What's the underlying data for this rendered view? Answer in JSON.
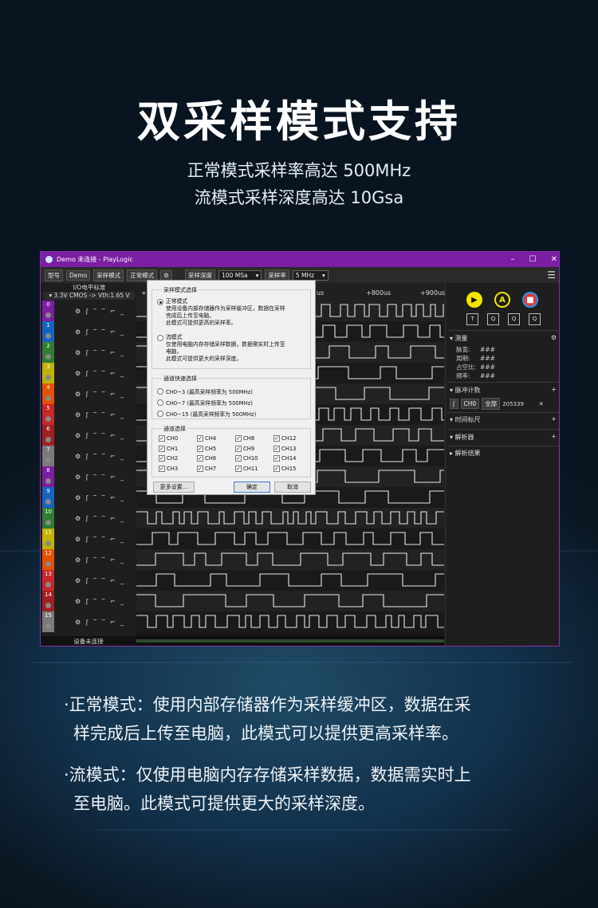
{
  "headline": "双采样模式支持",
  "subtitles": [
    "正常模式采样率高达 500MHz",
    "流模式采样深度高达 10Gsa"
  ],
  "app": {
    "title": "Demo 未连接 - PlayLogic",
    "toolbar": {
      "model_label": "型号",
      "model_value": "Demo",
      "mode_label": "采样模式",
      "mode_value": "正常模式",
      "depth_label": "采样深度",
      "depth_value": "100 MSa",
      "rate_label": "采样率",
      "rate_value": "5 MHz"
    },
    "io_header": "I/O电平标准",
    "io_level": "3.3V CMOS -> Vth:1.65 V",
    "channels": [
      {
        "num": "0",
        "color": "#7b1fa2"
      },
      {
        "num": "1",
        "color": "#1565c0"
      },
      {
        "num": "2",
        "color": "#2e7d32"
      },
      {
        "num": "3",
        "color": "#c0b400"
      },
      {
        "num": "4",
        "color": "#e65100"
      },
      {
        "num": "5",
        "color": "#c62828"
      },
      {
        "num": "6",
        "color": "#a02020"
      },
      {
        "num": "7",
        "color": "#7a7a7a"
      },
      {
        "num": "8",
        "color": "#7b1fa2"
      },
      {
        "num": "9",
        "color": "#1565c0"
      },
      {
        "num": "10",
        "color": "#2e7d32"
      },
      {
        "num": "11",
        "color": "#c0b400"
      },
      {
        "num": "12",
        "color": "#e65100"
      },
      {
        "num": "13",
        "color": "#c62828"
      },
      {
        "num": "14",
        "color": "#a02020"
      },
      {
        "num": "15",
        "color": "#7a7a7a"
      }
    ],
    "channel_controls": "⚙ ʃ ‾ ‾ ⌐ _",
    "status": "设备未连接",
    "ruler": {
      "left": "+0",
      "mid": "us",
      "t800": "+800us",
      "t900": "+900us"
    },
    "right": {
      "measure": {
        "title": "测量",
        "rows": [
          [
            "脉宽:",
            "###"
          ],
          [
            "周期:",
            "###"
          ],
          [
            "占空比:",
            "###"
          ],
          [
            "频率:",
            "###"
          ]
        ]
      },
      "pulse": {
        "title": "脉冲计数",
        "ch": "CH0",
        "all": "全部",
        "count": "205339"
      },
      "timing": "时间标尺",
      "decoder": "解析器",
      "result": "解析结果",
      "buttons": {
        "run": "▶",
        "auto": "A",
        "stop": "■"
      },
      "tools": [
        "T",
        "Q",
        "Q",
        "Q"
      ]
    },
    "dialog": {
      "title": "采样模式选择",
      "normal": {
        "label": "正常模式",
        "desc": [
          "使用设备内部存储器作为采样缓冲区，数据在采样",
          "完成后上传至电脑。",
          "此模式可提供更高的采样率。"
        ]
      },
      "stream": {
        "label": "流模式",
        "desc": [
          "仅使用电脑内存存储采样数据，数据需实时上传至",
          "电脑。",
          "此模式可提供更大的采样深度。"
        ]
      },
      "quick_title": "通道快速选择",
      "quick": [
        "CH0~3 (最高采样频率为 500MHz)",
        "CH0~7 (最高采样频率为 500MHz)",
        "CH0~15 (最高采样频率为 500MHz)"
      ],
      "ch_title": "通道选择",
      "chs": [
        "CH0",
        "CH4",
        "CH8",
        "CH12",
        "CH1",
        "CH5",
        "CH9",
        "CH13",
        "CH2",
        "CH6",
        "CH10",
        "CH14",
        "CH3",
        "CH7",
        "CH11",
        "CH15"
      ],
      "more": "更多设置...",
      "ok": "确定",
      "cancel": "取消"
    }
  },
  "bullets": [
    [
      "·正常模式：使用内部存储器作为采样缓冲区，数据在采",
      "样完成后上传至电脑，此模式可以提供更高采样率。"
    ],
    [
      "·流模式：仅使用电脑内存存储采样数据，数据需实时上",
      "至电脑。此模式可提供更大的采样深度。"
    ]
  ]
}
